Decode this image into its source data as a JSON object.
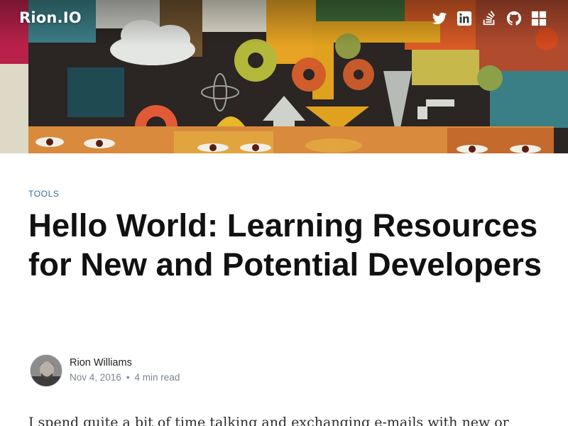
{
  "site": {
    "logo": "Rion.IO"
  },
  "social": [
    {
      "name": "twitter-icon"
    },
    {
      "name": "linkedin-icon"
    },
    {
      "name": "stackoverflow-icon"
    },
    {
      "name": "github-icon"
    },
    {
      "name": "windows-icon"
    }
  ],
  "article": {
    "tag": "TOOLS",
    "title": "Hello World: Learning Resources for New and Potential Developers",
    "author": "Rion Williams",
    "date": "Nov 4, 2016",
    "separator": "•",
    "read_time": "4 min read",
    "intro": "I spend quite a bit of time talking and exchanging e-mails with new or"
  },
  "colors": {
    "tag": "#2e6fa3",
    "title": "#111111",
    "meta": "#7a8590"
  }
}
